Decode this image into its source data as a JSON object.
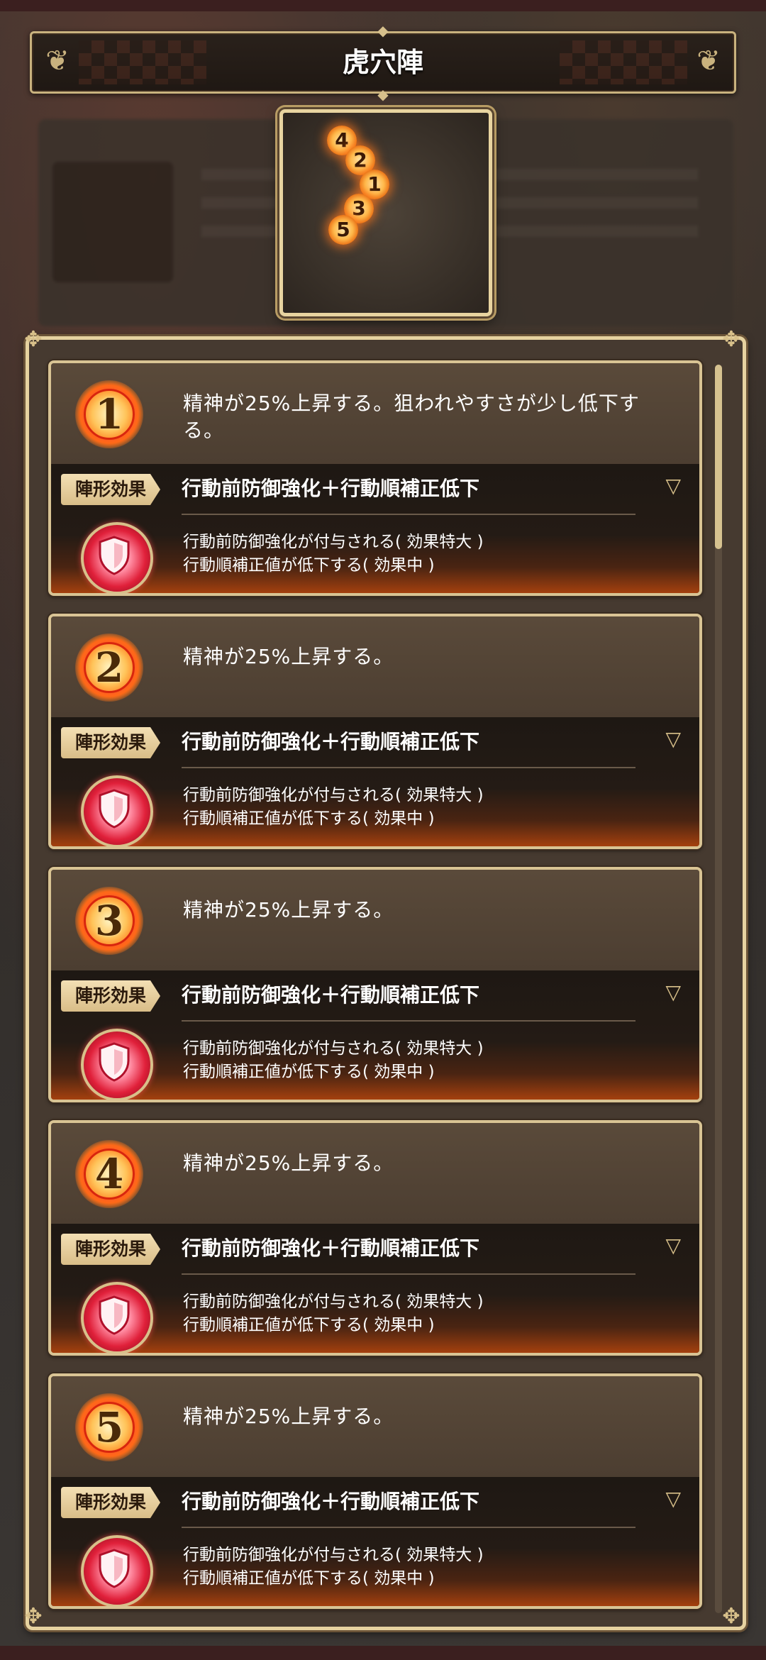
{
  "title": "虎穴陣",
  "formation": {
    "nodes": [
      "4",
      "2",
      "1",
      "3",
      "5"
    ]
  },
  "entries": [
    {
      "num": "1",
      "description": "精神が25%上昇する。狙われやすさが少し低下する。",
      "tag": "陣形効果",
      "effect_title": "行動前防御強化＋行動順補正低下",
      "line1": "行動前防御強化が付与される( 効果特大 )",
      "line2": "行動順補正値が低下する( 効果中 )"
    },
    {
      "num": "2",
      "description": "精神が25%上昇する。",
      "tag": "陣形効果",
      "effect_title": "行動前防御強化＋行動順補正低下",
      "line1": "行動前防御強化が付与される( 効果特大 )",
      "line2": "行動順補正値が低下する( 効果中 )"
    },
    {
      "num": "3",
      "description": "精神が25%上昇する。",
      "tag": "陣形効果",
      "effect_title": "行動前防御強化＋行動順補正低下",
      "line1": "行動前防御強化が付与される( 効果特大 )",
      "line2": "行動順補正値が低下する( 効果中 )"
    },
    {
      "num": "4",
      "description": "精神が25%上昇する。",
      "tag": "陣形効果",
      "effect_title": "行動前防御強化＋行動順補正低下",
      "line1": "行動前防御強化が付与される( 効果特大 )",
      "line2": "行動順補正値が低下する( 効果中 )"
    },
    {
      "num": "5",
      "description": "精神が25%上昇する。",
      "tag": "陣形効果",
      "effect_title": "行動前防御強化＋行動順補正低下",
      "line1": "行動前防御強化が付与される( 効果特大 )",
      "line2": "行動順補正値が低下する( 効果中 )"
    }
  ],
  "colors": {
    "frame_gold": "#e6d2a0",
    "accent_orange": "#ff7a1a",
    "shield_red": "#e0203a"
  },
  "icons": {
    "effect_icon": "shield-icon",
    "expand_icon": "chevron-down-icon"
  }
}
